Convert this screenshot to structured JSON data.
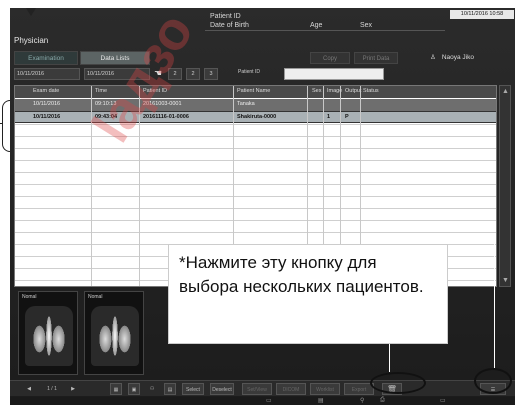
{
  "header": {
    "physician_label": "Physician",
    "patient_id_label": "Patient ID",
    "dob_label": "Date of Birth",
    "age_label": "Age",
    "sex_label": "Sex",
    "datetime": "10/11/2016 10:58"
  },
  "tabs": [
    {
      "label": "Examination",
      "active": false
    },
    {
      "label": "Data Lists",
      "active": true
    }
  ],
  "actions": {
    "copy_label": "Copy",
    "print_label": "Print Data"
  },
  "user": {
    "name": "Naoya Jiko",
    "icon": "user-icon"
  },
  "filter": {
    "from_date": "10/11/2016",
    "to_date": "10/11/2016",
    "btn1": "2",
    "btn2": "2",
    "btn3": "3",
    "patient_id_label": "Patient ID"
  },
  "table": {
    "columns": [
      "Exam date",
      "Time",
      "Patient ID",
      "Patient Name",
      "Sex",
      "Image",
      "Output Status"
    ],
    "rows": [
      {
        "date": "10/11/2016",
        "time": "09:10:13",
        "pid": "20161003-0001",
        "name": "Tanaka",
        "sex": "",
        "image": "",
        "status": ""
      },
      {
        "date": "10/11/2016",
        "time": "09:43:04",
        "pid": "20161116-01-0006",
        "name": "Shakiruta-0000",
        "sex": "",
        "image": "1",
        "status": "P"
      }
    ]
  },
  "thumbnails": [
    {
      "label": "Nomal"
    },
    {
      "label": "Nomal"
    }
  ],
  "toolbar": {
    "page": "1 / 1",
    "select_label": "Select All",
    "deselect_label": "Deselect",
    "btn_a": "Set/View",
    "btn_b": "DICOM Output",
    "btn_c": "Worklist",
    "btn_d": "Export",
    "trash_icon": "trash-icon",
    "multi_select_icon": "multi-select-icon"
  },
  "callout": {
    "text": "*Нажмите эту кнопку для выбора нескольких пациентов."
  },
  "watermark": {
    "text": "laдзо"
  }
}
